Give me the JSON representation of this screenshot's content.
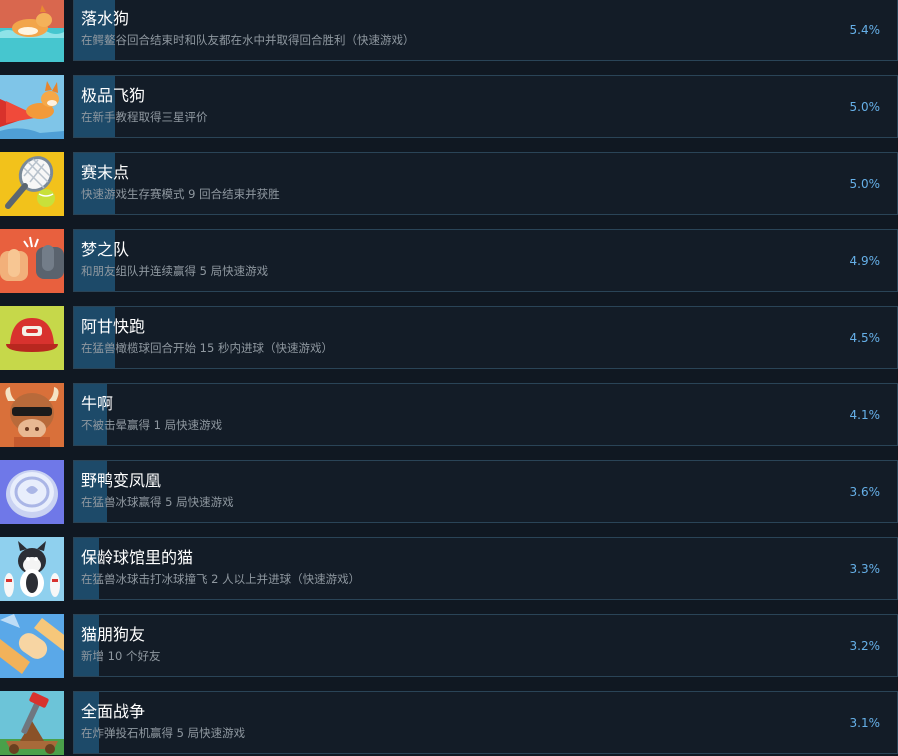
{
  "achievements": [
    {
      "title": "落水狗",
      "desc": "在鳄鳌谷回合结束时和队友都在水中并取得回合胜利（快速游戏）",
      "percent": "5.4%",
      "progress": 0.05,
      "icon": "corgi-swimming-icon"
    },
    {
      "title": "极品飞狗",
      "desc": "在新手教程取得三星评价",
      "percent": "5.0%",
      "progress": 0.05,
      "icon": "flying-dog-icon"
    },
    {
      "title": "赛末点",
      "desc": "快速游戏生存赛模式 9 回合结束并获胜",
      "percent": "5.0%",
      "progress": 0.05,
      "icon": "tennis-racket-icon"
    },
    {
      "title": "梦之队",
      "desc": "和朋友组队并连续赢得 5 局快速游戏",
      "percent": "4.9%",
      "progress": 0.05,
      "icon": "fist-bump-icon"
    },
    {
      "title": "阿甘快跑",
      "desc": "在猛兽橄榄球回合开始 15 秒内进球（快速游戏）",
      "percent": "4.5%",
      "progress": 0.05,
      "icon": "red-cap-icon"
    },
    {
      "title": "牛啊",
      "desc": "不被击晕赢得 1 局快速游戏",
      "percent": "4.1%",
      "progress": 0.04,
      "icon": "bull-sunglasses-icon"
    },
    {
      "title": "野鸭变凤凰",
      "desc": "在猛兽冰球赢得 5 局快速游戏",
      "percent": "3.6%",
      "progress": 0.04,
      "icon": "puck-icon"
    },
    {
      "title": "保龄球馆里的猫",
      "desc": "在猛兽冰球击打冰球撞飞 2 人以上并进球（快速游戏）",
      "percent": "3.3%",
      "progress": 0.03,
      "icon": "bowling-cat-icon"
    },
    {
      "title": "猫朋狗友",
      "desc": "新增 10 个好友",
      "percent": "3.2%",
      "progress": 0.03,
      "icon": "paw-handshake-icon"
    },
    {
      "title": "全面战争",
      "desc": "在炸弹投石机赢得 5 局快速游戏",
      "percent": "3.1%",
      "progress": 0.03,
      "icon": "catapult-icon"
    }
  ]
}
